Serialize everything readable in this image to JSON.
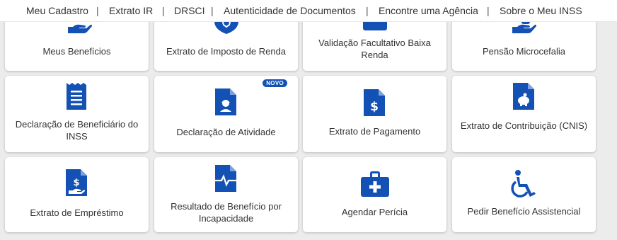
{
  "nav": {
    "items": [
      "Meu Cadastro",
      "Extrato IR",
      "DRSCI",
      "Autenticidade de Documentos",
      "Encontre uma Agência",
      "Sobre o Meu INSS"
    ],
    "separator": "|"
  },
  "colors": {
    "icon_blue": "#1351b4",
    "card_bg": "#ffffff",
    "page_bg": "#ececec"
  },
  "cards": [
    {
      "label": "Meus Benefícios",
      "icon": "hand-money-icon"
    },
    {
      "label": "Extrato de Imposto de Renda",
      "icon": "lion-shield-icon"
    },
    {
      "label": "Validação Facultativo Baixa Renda",
      "icon": "id-card-icon"
    },
    {
      "label": "Pensão Microcefalia",
      "icon": "hand-baby-icon"
    },
    {
      "label": "Declaração de Beneficiário do INSS",
      "icon": "receipt-icon"
    },
    {
      "label": "Declaração de Atividade",
      "icon": "worker-document-icon",
      "badge": "NOVO"
    },
    {
      "label": "Extrato de Pagamento",
      "icon": "dollar-document-icon"
    },
    {
      "label": "Extrato de Contribuição (CNIS)",
      "icon": "piggy-document-icon"
    },
    {
      "label": "Extrato de Empréstimo",
      "icon": "loan-document-icon"
    },
    {
      "label": "Resultado de Benefício por Incapacidade",
      "icon": "heartbeat-document-icon"
    },
    {
      "label": "Agendar Perícia",
      "icon": "medical-kit-icon"
    },
    {
      "label": "Pedir Benefício Assistencial",
      "icon": "wheelchair-icon"
    }
  ]
}
